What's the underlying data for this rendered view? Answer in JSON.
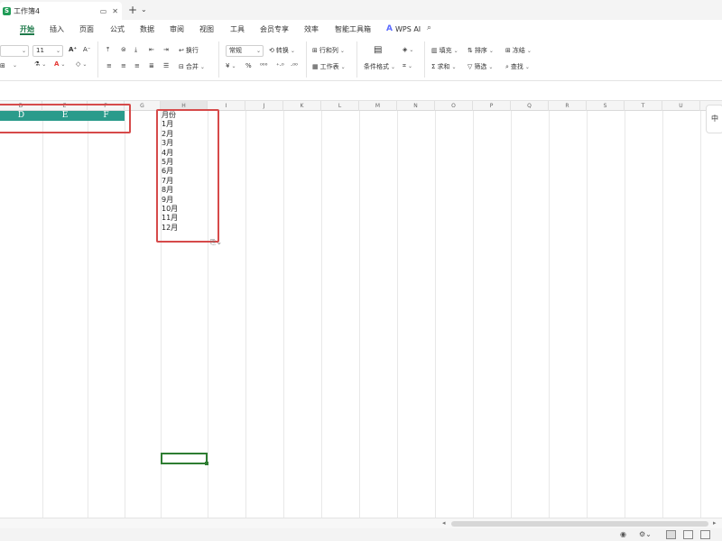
{
  "window": {
    "doc_tab_title": "工作簿4",
    "sheet_icon_letter": "S",
    "new_tab_symbol": "+",
    "dropdown_symbol": "⌄"
  },
  "menu": {
    "items": [
      "开始",
      "插入",
      "页面",
      "公式",
      "数据",
      "审阅",
      "视图",
      "工具",
      "会员专享",
      "效率",
      "智能工具箱"
    ],
    "active": "开始",
    "wps_ai_label": "WPS AI"
  },
  "ribbon": {
    "font_size": "11",
    "number_format": "常规",
    "wrap_label": "换行",
    "merge_label": "合并",
    "convert_label": "转换",
    "row_col_label": "行和列",
    "worksheet_label": "工作表",
    "cond_format_label": "条件格式",
    "fill_label": "填充",
    "sort_label": "排序",
    "freeze_label": "冻结",
    "sum_label": "求和",
    "filter_label": "筛选",
    "find_label": "查找",
    "currency_symbol": "¥",
    "percent_symbol": "%"
  },
  "grid": {
    "columns": [
      "D",
      "E",
      "F",
      "G",
      "H",
      "I",
      "J",
      "K",
      "L",
      "M",
      "N",
      "O",
      "P",
      "Q",
      "R",
      "S",
      "T",
      "U"
    ],
    "header_row": [
      "D",
      "E",
      "F"
    ],
    "header_row_color": "#2b9b8b",
    "month_column_title": "月份",
    "months": [
      "1月",
      "2月",
      "3月",
      "4月",
      "5月",
      "6月",
      "7月",
      "8月",
      "9月",
      "10月",
      "11月",
      "12月"
    ],
    "highlight_color": "#d64a4a",
    "selected_cell_color": "#2e7d32",
    "side_widget_label": "中"
  },
  "colors": {
    "accent": "#1e7a4a",
    "font_color": "#e53935",
    "fill_color": "#f2c200"
  }
}
